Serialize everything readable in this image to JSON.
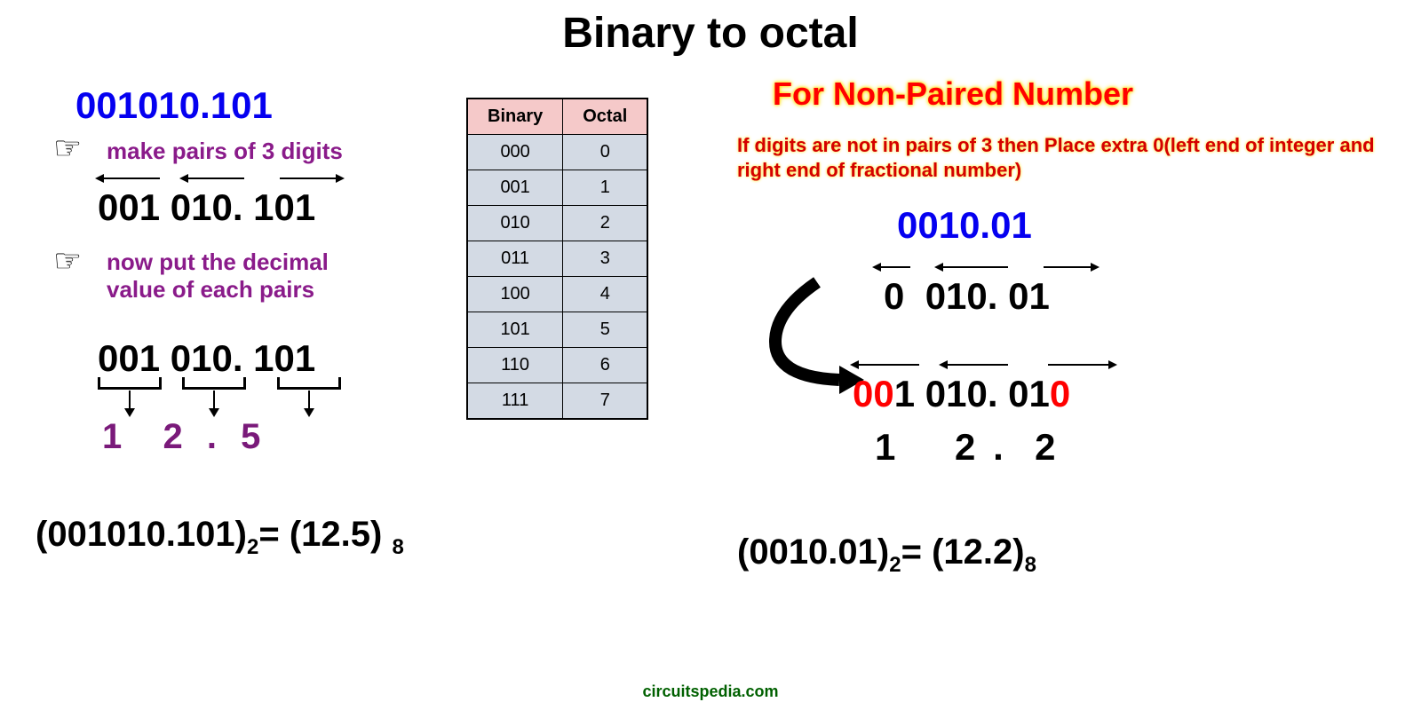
{
  "title": "Binary to octal",
  "left": {
    "binary_input": "001010.101",
    "step1": "make pairs of 3 digits",
    "step2_line1": "now put the decimal",
    "step2_line2": "value of each pairs",
    "pairs_display_1": "001",
    "pairs_display_2": "010",
    "pairs_display_3": "101",
    "period": ".",
    "octal_1": "1",
    "octal_2": "2",
    "octal_3": "5",
    "result_lhs": "(001010.101)",
    "result_lhs_sub": "2",
    "result_eq": "= ",
    "result_rhs": "(12.5)",
    "result_rhs_sub": "8"
  },
  "table": {
    "h1": "Binary",
    "h2": "Octal",
    "rows": [
      {
        "b": "000",
        "o": "0"
      },
      {
        "b": "001",
        "o": "1"
      },
      {
        "b": "010",
        "o": "2"
      },
      {
        "b": "011",
        "o": "3"
      },
      {
        "b": "100",
        "o": "4"
      },
      {
        "b": "101",
        "o": "5"
      },
      {
        "b": "110",
        "o": "6"
      },
      {
        "b": "111",
        "o": "7"
      }
    ]
  },
  "right": {
    "heading": "For Non-Paired Number",
    "note": "If digits are not in pairs of 3 then Place extra 0(left end of integer and right end of fractional number)",
    "binary_input": "0010.01",
    "unpadded_g1": "0",
    "unpadded_g2": "010",
    "unpadded_g3": "01",
    "period": ".",
    "pad1": "00",
    "pad1_keep": "1",
    "pad2": "010",
    "pad3_keep": "01",
    "pad3": "0",
    "octal_1": "1",
    "octal_2": "2",
    "octal_3": "2",
    "result_lhs": "(0010.01)",
    "result_lhs_sub": "2",
    "result_eq": "= ",
    "result_rhs": "(12.2)",
    "result_rhs_sub": "8"
  },
  "footer": "circuitspedia.com"
}
